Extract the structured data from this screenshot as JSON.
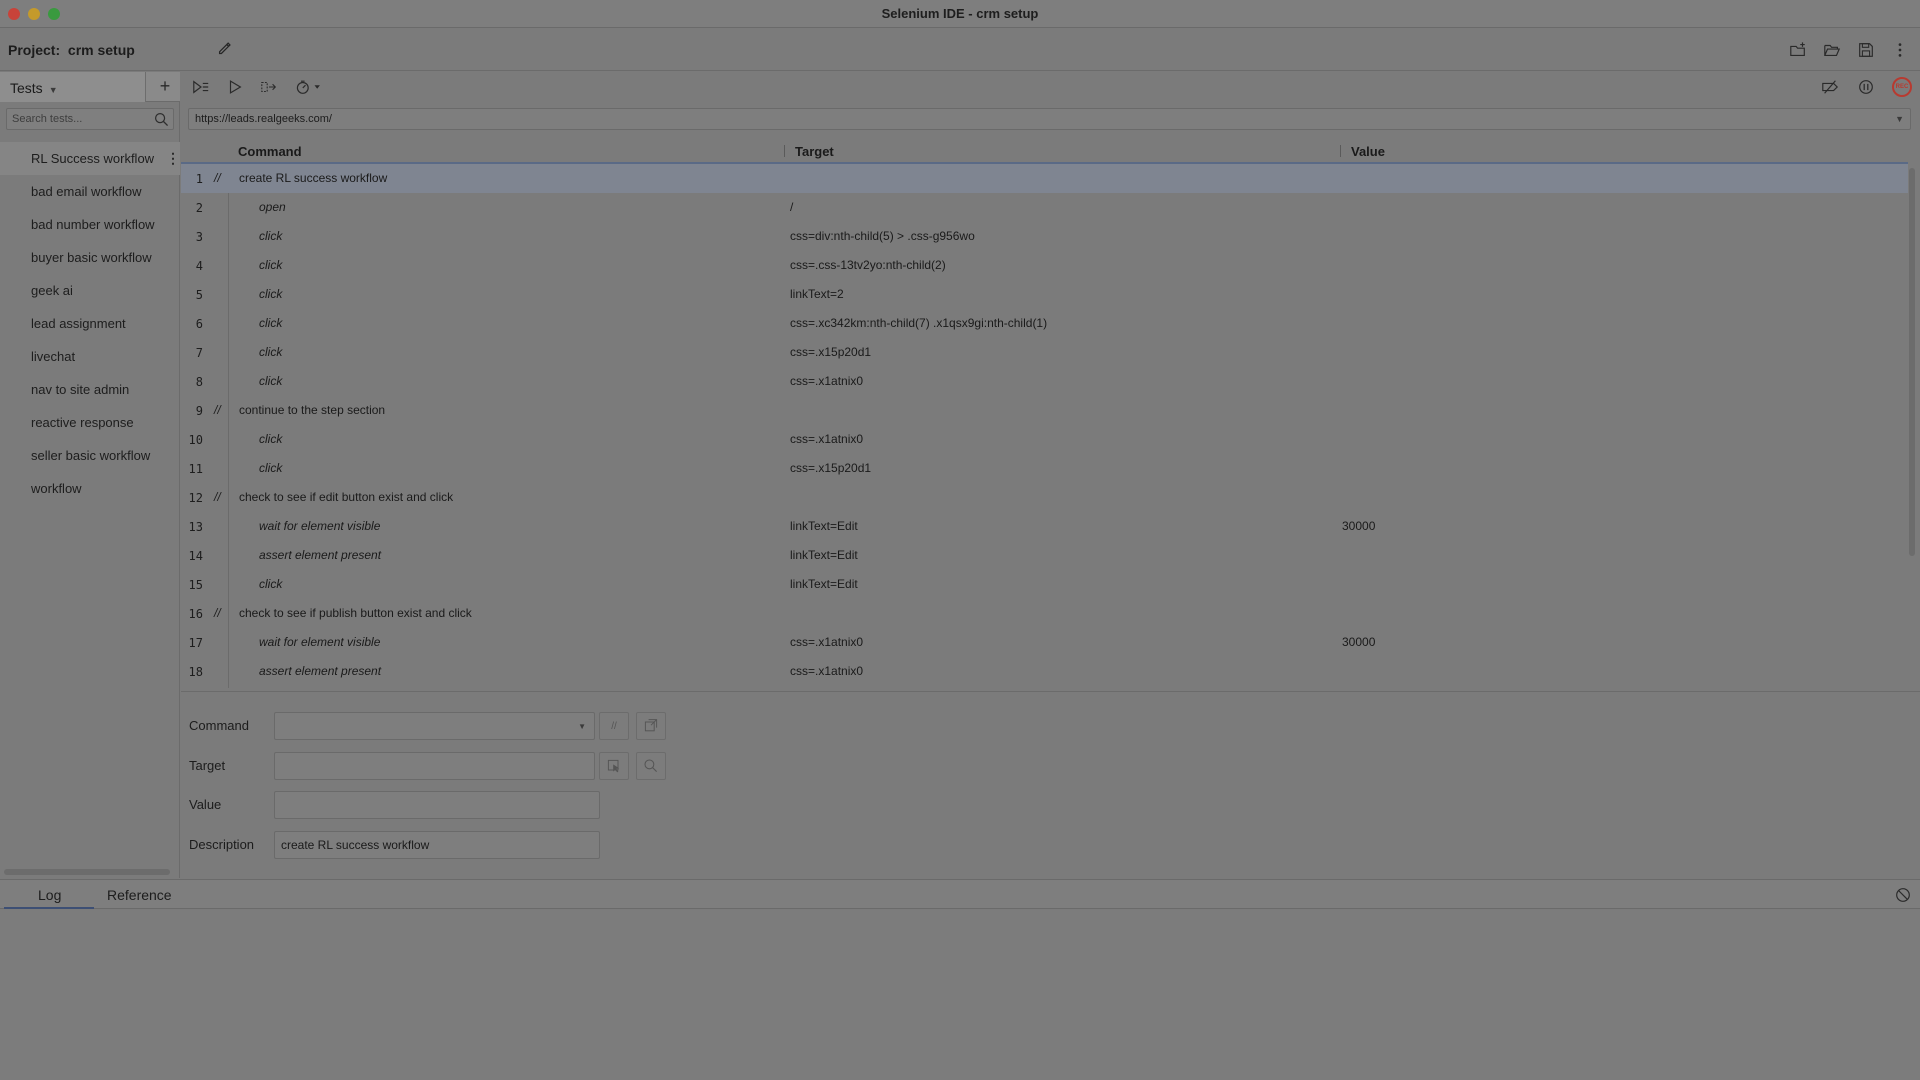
{
  "window": {
    "title": "Selenium IDE - crm setup"
  },
  "project": {
    "label": "Project:",
    "name": "crm setup"
  },
  "sidebar": {
    "tests_label": "Tests",
    "search_placeholder": "Search tests...",
    "tests": [
      "RL Success workflow",
      "bad email workflow",
      "bad number workflow",
      "buyer basic workflow",
      "geek ai",
      "lead assignment",
      "livechat",
      "nav to site admin",
      "reactive response",
      "seller basic workflow",
      "workflow"
    ]
  },
  "url": {
    "value": "https://leads.realgeeks.com/"
  },
  "table": {
    "headers": {
      "command": "Command",
      "target": "Target",
      "value": "Value"
    },
    "rows": [
      {
        "n": "1",
        "comment": true,
        "command": "create RL success workflow",
        "target": "",
        "value": ""
      },
      {
        "n": "2",
        "comment": false,
        "command": "open",
        "target": "/",
        "value": ""
      },
      {
        "n": "3",
        "comment": false,
        "command": "click",
        "target": "css=div:nth-child(5) > .css-g956wo",
        "value": ""
      },
      {
        "n": "4",
        "comment": false,
        "command": "click",
        "target": "css=.css-13tv2yo:nth-child(2)",
        "value": ""
      },
      {
        "n": "5",
        "comment": false,
        "command": "click",
        "target": "linkText=2",
        "value": ""
      },
      {
        "n": "6",
        "comment": false,
        "command": "click",
        "target": "css=.xc342km:nth-child(7) .x1qsx9gi:nth-child(1)",
        "value": ""
      },
      {
        "n": "7",
        "comment": false,
        "command": "click",
        "target": "css=.x15p20d1",
        "value": ""
      },
      {
        "n": "8",
        "comment": false,
        "command": "click",
        "target": "css=.x1atnix0",
        "value": ""
      },
      {
        "n": "9",
        "comment": true,
        "command": "continue to the step section",
        "target": "",
        "value": ""
      },
      {
        "n": "10",
        "comment": false,
        "command": "click",
        "target": "css=.x1atnix0",
        "value": ""
      },
      {
        "n": "11",
        "comment": false,
        "command": "click",
        "target": "css=.x15p20d1",
        "value": ""
      },
      {
        "n": "12",
        "comment": true,
        "command": "check to see if edit button exist and click",
        "target": "",
        "value": ""
      },
      {
        "n": "13",
        "comment": false,
        "command": "wait for element visible",
        "target": "linkText=Edit",
        "value": "30000"
      },
      {
        "n": "14",
        "comment": false,
        "command": "assert element present",
        "target": "linkText=Edit",
        "value": ""
      },
      {
        "n": "15",
        "comment": false,
        "command": "click",
        "target": "linkText=Edit",
        "value": ""
      },
      {
        "n": "16",
        "comment": true,
        "command": "check to see if publish button exist and click",
        "target": "",
        "value": ""
      },
      {
        "n": "17",
        "comment": false,
        "command": "wait for element visible",
        "target": "css=.x1atnix0",
        "value": "30000"
      },
      {
        "n": "18",
        "comment": false,
        "command": "assert element present",
        "target": "css=.x1atnix0",
        "value": ""
      }
    ],
    "comment_marker": "//"
  },
  "editor": {
    "command_label": "Command",
    "target_label": "Target",
    "value_label": "Value",
    "description_label": "Description",
    "command_value": "",
    "target_value": "",
    "value_value": "",
    "description_value": "create RL success workflow",
    "comment_toggle": "//"
  },
  "bottom": {
    "log_tab": "Log",
    "reference_tab": "Reference"
  },
  "toolbar": {
    "rec_label": "REC"
  },
  "colors": {
    "rec": "#b83a30",
    "selected_row": "#7f8591",
    "tab_underline": "#3d4f74"
  }
}
